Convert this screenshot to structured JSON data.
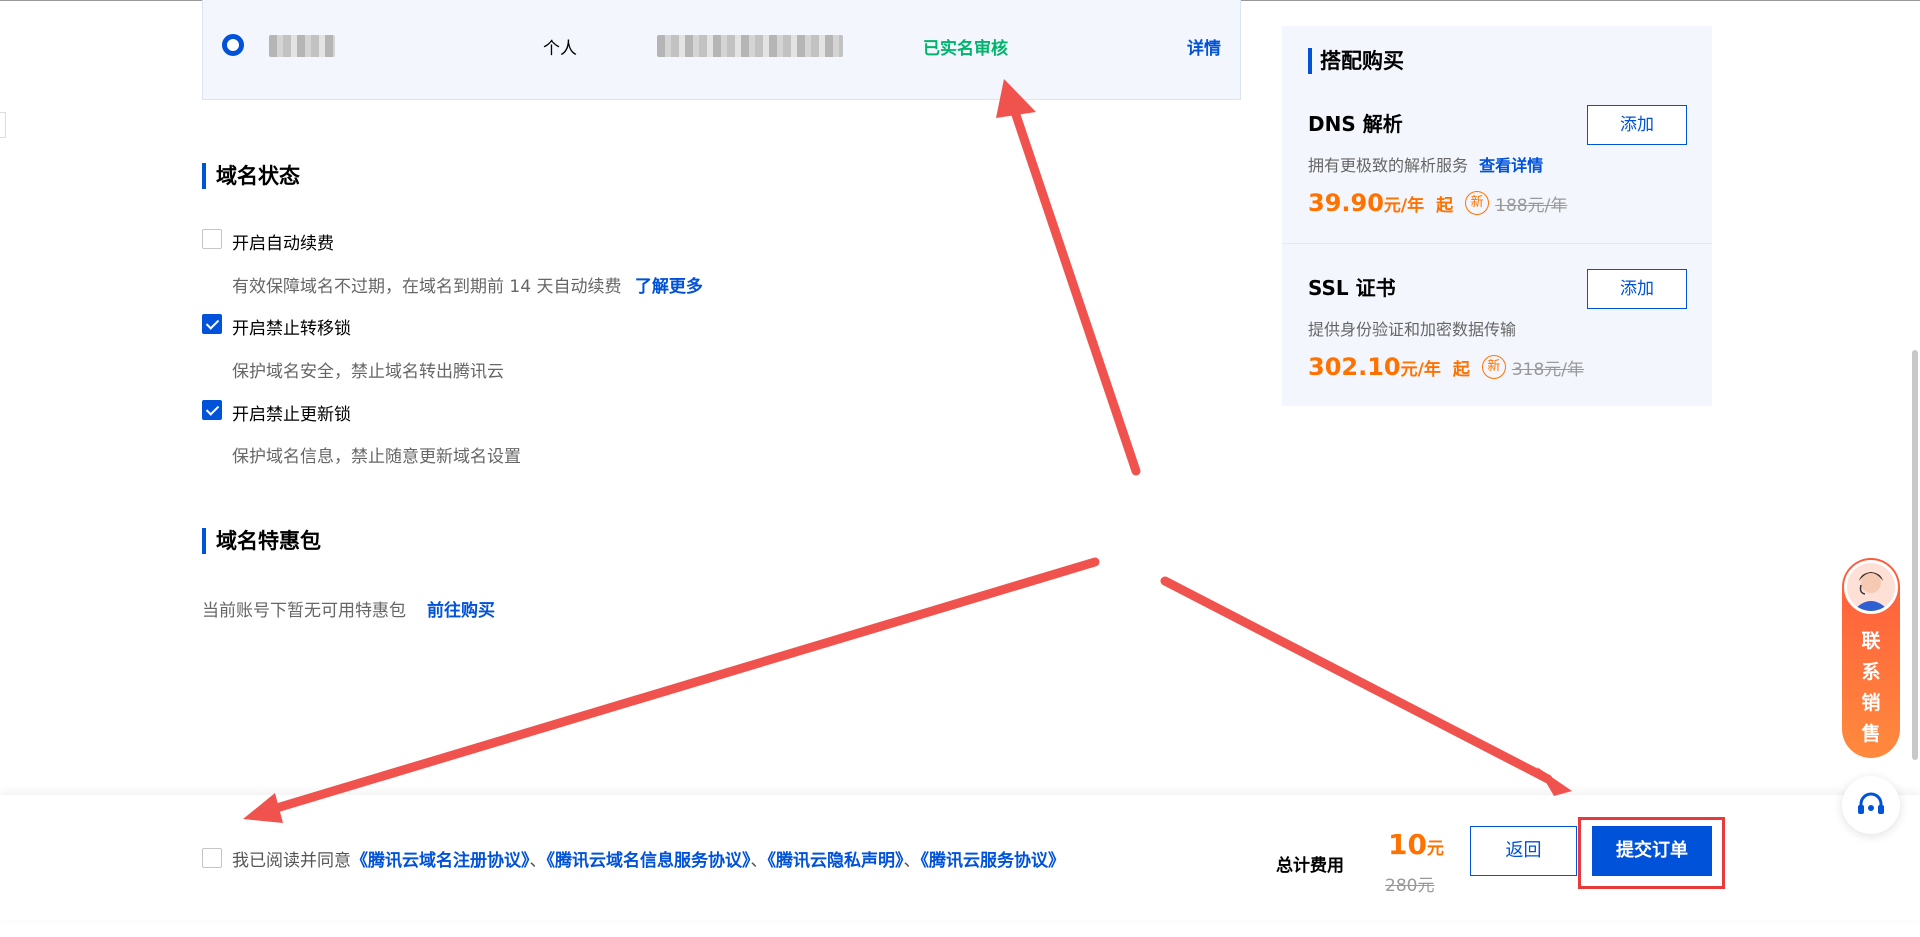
{
  "registrant": {
    "type": "个人",
    "status": "已实名审核",
    "detail_link": "详情"
  },
  "domain_status": {
    "title": "域名状态",
    "options": [
      {
        "label": "开启自动续费",
        "checked": false,
        "desc": "有效保障域名不过期，在域名到期前 14 天自动续费",
        "link": "了解更多"
      },
      {
        "label": "开启禁止转移锁",
        "checked": true,
        "desc": "保护域名安全，禁止域名转出腾讯云"
      },
      {
        "label": "开启禁止更新锁",
        "checked": true,
        "desc": "保护域名信息，禁止随意更新域名设置"
      }
    ]
  },
  "promo_pack": {
    "title": "域名特惠包",
    "text": "当前账号下暂无可用特惠包",
    "link": "前往购买"
  },
  "addons": {
    "title": "搭配购买",
    "items": [
      {
        "name": "DNS 解析",
        "desc": "拥有更极致的解析服务",
        "desc_link": "查看详情",
        "price": "39.90",
        "unit": "元/年",
        "qi": "起",
        "badge": "新",
        "old_price": "188元/年",
        "button": "添加"
      },
      {
        "name": "SSL 证书",
        "desc": "提供身份验证和加密数据传输",
        "price": "302.10",
        "unit": "元/年",
        "qi": "起",
        "badge": "新",
        "old_price": "318元/年",
        "button": "添加"
      }
    ]
  },
  "footer": {
    "agree_prefix": "我已阅读并同意",
    "agreements": [
      "《腾讯云域名注册协议》",
      "《腾讯云域名信息服务协议》",
      "《腾讯云隐私声明》",
      "《腾讯云服务协议》"
    ],
    "separator": "、",
    "total_label": "总计费用",
    "total_value": "10",
    "total_unit": "元",
    "total_old": "280元",
    "back_button": "返回",
    "submit_button": "提交订单"
  },
  "contact": {
    "text": "联系销售",
    "icon": "headset-icon"
  },
  "colors": {
    "primary": "#0052d9",
    "price": "#ff7200",
    "verified": "#00b46e",
    "annotation": "#e83a3a"
  }
}
